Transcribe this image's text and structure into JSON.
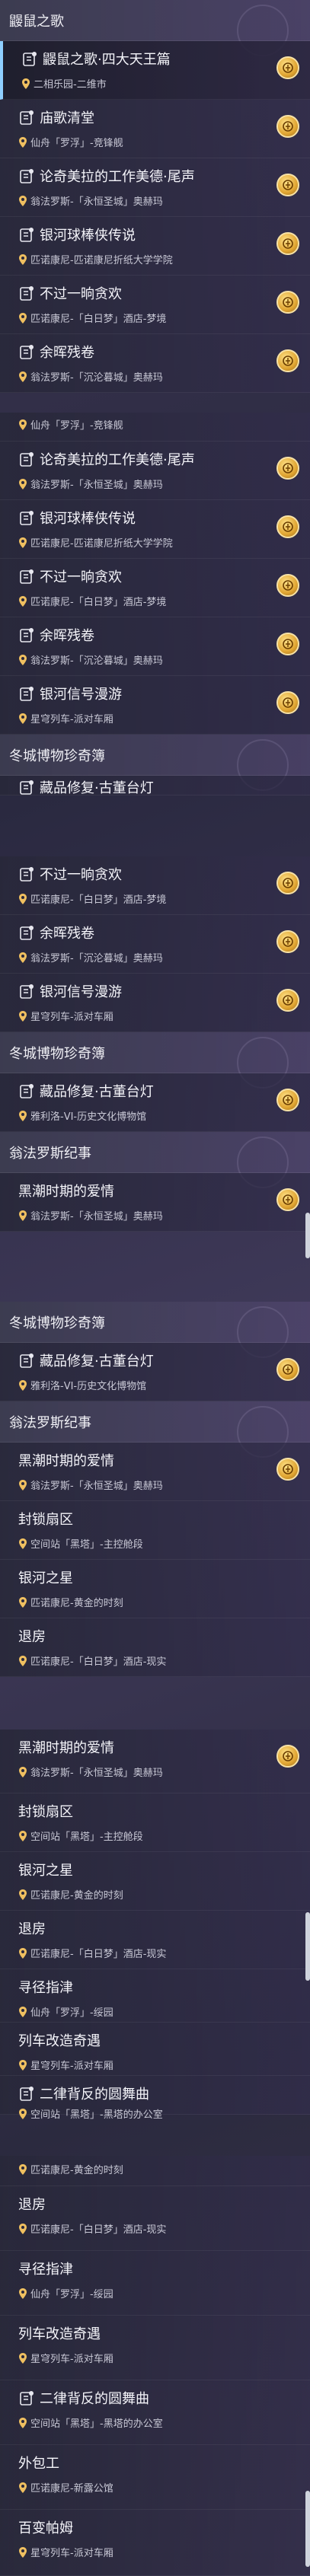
{
  "strip1": {
    "category": "鼹鼠之歌",
    "items": [
      {
        "title": "鼹鼠之歌·四大天王篇",
        "location": "二相乐园-二维市",
        "selected": true,
        "badge": true
      },
      {
        "title": "庙歌清堂",
        "location": "仙舟「罗浮」-竞锋舰",
        "selected": false,
        "badge": true
      },
      {
        "title": "论奇美拉的工作美德·尾声",
        "location": "翁法罗斯-「永恒圣城」奥赫玛",
        "selected": false,
        "badge": true
      },
      {
        "title": "银河球棒侠传说",
        "location": "匹诺康尼-匹诺康尼折纸大学学院",
        "selected": false,
        "badge": true
      },
      {
        "title": "不过一晌贪欢",
        "location": "匹诺康尼-「白日梦」酒店-梦境",
        "selected": false,
        "badge": true
      },
      {
        "title": "余晖残卷",
        "location": "翁法罗斯-「沉沦暮城」奥赫玛",
        "selected": false,
        "badge": true
      }
    ]
  },
  "strip2": {
    "partial_location": "仙舟「罗浮」-竞锋舰",
    "items": [
      {
        "title": "论奇美拉的工作美德·尾声",
        "location": "翁法罗斯-「永恒圣城」奥赫玛",
        "badge": true
      },
      {
        "title": "银河球棒侠传说",
        "location": "匹诺康尼-匹诺康尼折纸大学学院",
        "badge": true
      },
      {
        "title": "不过一晌贪欢",
        "location": "匹诺康尼-「白日梦」酒店-梦境",
        "badge": true
      },
      {
        "title": "余晖残卷",
        "location": "翁法罗斯-「沉沦暮城」奥赫玛",
        "badge": true
      },
      {
        "title": "银河信号漫游",
        "location": "星穹列车-派对车厢",
        "badge": true
      }
    ],
    "category": "冬城博物珍奇簿",
    "partial_title": "藏品修复·古董台灯"
  },
  "strip3": {
    "items": [
      {
        "title": "不过一晌贪欢",
        "location": "匹诺康尼-「白日梦」酒店-梦境",
        "badge": true
      },
      {
        "title": "余晖残卷",
        "location": "翁法罗斯-「沉沦暮城」奥赫玛",
        "badge": true
      },
      {
        "title": "银河信号漫游",
        "location": "星穹列车-派对车厢",
        "badge": true
      }
    ],
    "category1": "冬城博物珍奇簿",
    "item_museum": {
      "title": "藏品修复·古董台灯",
      "location": "雅利洛-VI-历史文化博物馆",
      "badge": true
    },
    "category2": "翁法罗斯纪事",
    "item_tide": {
      "title": "黑潮时期的爱情",
      "location": "翁法罗斯-「永恒圣城」奥赫玛",
      "badge": true
    }
  },
  "strip4": {
    "category1": "冬城博物珍奇簿",
    "item_museum": {
      "title": "藏品修复·古董台灯",
      "location": "雅利洛-VI-历史文化博物馆",
      "badge": true
    },
    "category2": "翁法罗斯纪事",
    "items": [
      {
        "title": "黑潮时期的爱情",
        "location": "翁法罗斯-「永恒圣城」奥赫玛",
        "badge": true
      },
      {
        "title": "封锁扇区",
        "location": "空间站「黑塔」-主控舱段",
        "badge": false
      },
      {
        "title": "银河之星",
        "location": "匹诺康尼-黄金的时刻",
        "badge": false
      },
      {
        "title": "退房",
        "location": "匹诺康尼-「白日梦」酒店-现实",
        "badge": false
      }
    ]
  },
  "strip5": {
    "items": [
      {
        "title": "黑潮时期的爱情",
        "location": "翁法罗斯-「永恒圣城」奥赫玛",
        "badge": true
      },
      {
        "title": "封锁扇区",
        "location": "空间站「黑塔」-主控舱段",
        "badge": false
      },
      {
        "title": "银河之星",
        "location": "匹诺康尼-黄金的时刻",
        "badge": false
      },
      {
        "title": "退房",
        "location": "匹诺康尼-「白日梦」酒店-现实",
        "badge": false
      },
      {
        "title": "寻径指津",
        "location": "仙舟「罗浮」-绥园",
        "badge": false
      },
      {
        "title": "列车改造奇遇",
        "location": "星穹列车-派对车厢",
        "badge": false
      },
      {
        "title": "二律背反的圆舞曲",
        "location": "空间站「黑塔」-黑塔的办公室",
        "badge": false
      }
    ]
  },
  "strip6": {
    "partial_location": "匹诺康尼-黄金的时刻",
    "items": [
      {
        "title": "退房",
        "location": "匹诺康尼-「白日梦」酒店-现实",
        "badge": false
      },
      {
        "title": "寻径指津",
        "location": "仙舟「罗浮」-绥园",
        "badge": false
      },
      {
        "title": "列车改造奇遇",
        "location": "星穹列车-派对车厢",
        "badge": false
      },
      {
        "title": "二律背反的圆舞曲",
        "location": "空间站「黑塔」-黑塔的办公室",
        "badge": false
      },
      {
        "title": "外包工",
        "location": "匹诺康尼-新露公馆",
        "badge": false
      },
      {
        "title": "百变帕姆",
        "location": "星穹列车-派对车厢",
        "badge": false
      }
    ]
  }
}
